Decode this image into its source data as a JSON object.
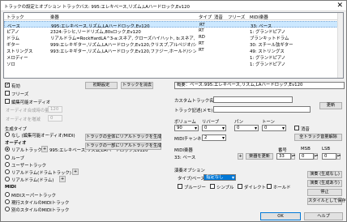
{
  "window": {
    "title": "トラックの設定とオプション トラックバス: 995:エレキベース,リズム,LAハードロック,Ev120",
    "close": "✕"
  },
  "table": {
    "headers": [
      "トラック",
      "楽器",
      "タイプ",
      "消音",
      "フリーズ",
      "MIDI楽器"
    ],
    "rows": [
      [
        "ベース",
        "995:エレキベース,リズム,LAハードロック,Ev120",
        "RT",
        "",
        "",
        "33: ベース"
      ],
      [
        "ピアノ",
        "2324:ラシヒ,リードリズム,80sロック,Ev120",
        "RT",
        "",
        "",
        "1: グランドピアノ"
      ],
      [
        "ドラム",
        "リアルドラム=RockHardLA^3-a:スネア, クローズハイハット, b:スネア, ベルライド",
        "RD",
        "",
        "",
        "ブランキットドラム"
      ],
      [
        "ギター",
        "999:エレキギター,リズム,LAハードロック,Ev120,クリスプ,アルペジオ/シンコペーション",
        "RT",
        "",
        "",
        "30: スチール弦ギター"
      ],
      [
        "ストリングス",
        "993:エレキギター,リズム,LAハードロック,Ev120,ファジー,ホールド/シンコペーション",
        "RT",
        "",
        "",
        "49: ストリングス"
      ],
      [
        "メロディー",
        "",
        "",
        "",
        "",
        "1: グランドピアノ"
      ],
      [
        "ソロ",
        "",
        "",
        "",
        "",
        "1: グランドピアノ"
      ]
    ]
  },
  "left": {
    "enabled": "有効",
    "freeze": "フリーズ",
    "edit_audio": "編集可能オーディオ",
    "audio_merge_amount": "オーディオ合成時の量",
    "audio_merge_value": "120",
    "audio_volume": "オーディオを増減",
    "audio_volume_value": "0",
    "init_button": "初期設定",
    "clear_track_button": "トラックを消去",
    "gen_type": "生成タイプ",
    "gen_type_option": "なし (編集可能オーディオ/MIDI)",
    "audio_header": "オーディオ",
    "real_track": "リアルトラック",
    "real_track_value": "995:エレキベース,リズム,LAハードロック,Ev120",
    "loop": "ループ",
    "user_track": "ユーザートラック",
    "real_drum": "リアルドラム(ドラムトラック)",
    "real_style": "リアルドラム(ドラム)",
    "midi_header": "MIDI",
    "midi_super": "MIDIスーパートラック",
    "midi_style": "現行スタイルのMIDIトラック",
    "midi_other": "別のスタイルのMIDIトラック",
    "gen_whole_button": "トラックの全体にリアルトラックを生成",
    "gen_part_button": "トラックの一部にリアルトラックを生成",
    "plus": "+"
  },
  "right": {
    "summary": "概要：ベース:995:エレキベース,リズム,LAハードロック,Ev120",
    "custom_name_label": "カスタムトラック名",
    "track_memo_label": "トラック記述(メモ)",
    "update_button": "更新",
    "volume_label": "ボリューム",
    "reverb_label": "リバーブ",
    "pan_label": "パン",
    "tone_label": "トーン",
    "volume_value": "90",
    "reverb_value": "0",
    "pan_value": "0",
    "tone_value": "0",
    "mute_label": "消音",
    "channel_label": "MIDIチャンネル",
    "channel_value": "2",
    "all_track_volume_button": "全トラック音量解除",
    "midi_instrument_label": "MIDI楽器",
    "midi_instrument_value": "33: ベース",
    "number_label": "番号",
    "msb_label": "MSB",
    "lsb_label": "LSB",
    "number_value": "33",
    "msb_value": "0",
    "lsb_value": "0",
    "instrument_update_button": "楽器を更新",
    "perf_options_label": "演奏オプション",
    "type_label": "タイプ/ベース",
    "type_value": "指定なし",
    "bluesy": "ブルージー",
    "simple": "シンプル",
    "direct": "ダイレクト",
    "hold": "ホールド",
    "perf_gen_button": "演奏 (生成なし)",
    "perf_gen_button2": "演奏 (生成あり)",
    "stop_button": "停止",
    "style_save_button": "スタイルとして保存",
    "ok_button": "OK",
    "help_button": "ヘルプ"
  }
}
